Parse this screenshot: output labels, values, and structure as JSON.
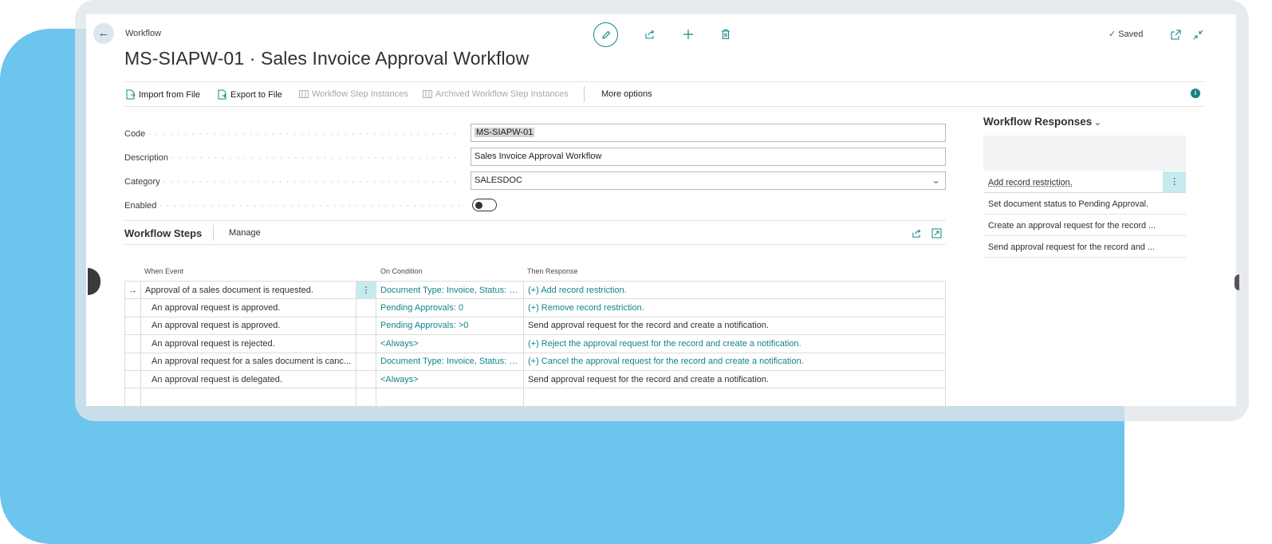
{
  "window": {
    "breadcrumb": "Workflow",
    "title": "MS-SIAPW-01 · Sales Invoice Approval Workflow",
    "saved_label": "Saved"
  },
  "actions": [
    {
      "label": "Import from File",
      "icon": "import-file-icon",
      "enabled": true
    },
    {
      "label": "Export to File",
      "icon": "export-file-icon",
      "enabled": true
    },
    {
      "label": "Workflow Step Instances",
      "icon": "table-icon",
      "enabled": false
    },
    {
      "label": "Archived Workflow Step Instances",
      "icon": "table-icon",
      "enabled": false
    },
    {
      "label": "More options",
      "icon": "",
      "enabled": true
    }
  ],
  "fields": {
    "code": {
      "label": "Code",
      "value": "MS-SIAPW-01"
    },
    "description": {
      "label": "Description",
      "value": "Sales Invoice Approval Workflow"
    },
    "category": {
      "label": "Category",
      "value": "SALESDOC"
    },
    "enabled": {
      "label": "Enabled",
      "value": false
    }
  },
  "steps": {
    "title": "Workflow Steps",
    "manage_label": "Manage",
    "columns": [
      "When Event",
      "On Condition",
      "Then Response"
    ],
    "rows": [
      {
        "event": "Approval of a sales document is requested.",
        "condition": "Document Type: Invoice, Status: O...",
        "response": "(+) Add record restriction.",
        "response_link": true,
        "current": true
      },
      {
        "event": "An approval request is approved.",
        "condition": "Pending Approvals: 0",
        "response": "(+) Remove record restriction.",
        "response_link": true,
        "current": false
      },
      {
        "event": "An approval request is approved.",
        "condition": "Pending Approvals: >0",
        "response": "Send approval request for the record and create a notification.",
        "response_link": false,
        "current": false
      },
      {
        "event": "An approval request is rejected.",
        "condition": "<Always>",
        "response": "(+) Reject the approval request for the record and create a notification.",
        "response_link": true,
        "current": false
      },
      {
        "event": "An approval request for a sales document is canc...",
        "condition": "Document Type: Invoice, Status: P...",
        "response": "(+) Cancel the approval request for the record and create a notification.",
        "response_link": true,
        "current": false
      },
      {
        "event": "An approval request is delegated.",
        "condition": "<Always>",
        "response": "Send approval request for the record and create a notification.",
        "response_link": false,
        "current": false
      }
    ]
  },
  "side_panel": {
    "title": "Workflow Responses",
    "items": [
      "Add record restriction.",
      "Set document status to Pending Approval.",
      "Create an approval request for the record ...",
      "Send approval request for the record and ..."
    ]
  },
  "colors": {
    "accent": "#13888d",
    "link": "#13838f",
    "background_blob": "#6cc5ec",
    "row_highlight": "#c6ebef"
  }
}
